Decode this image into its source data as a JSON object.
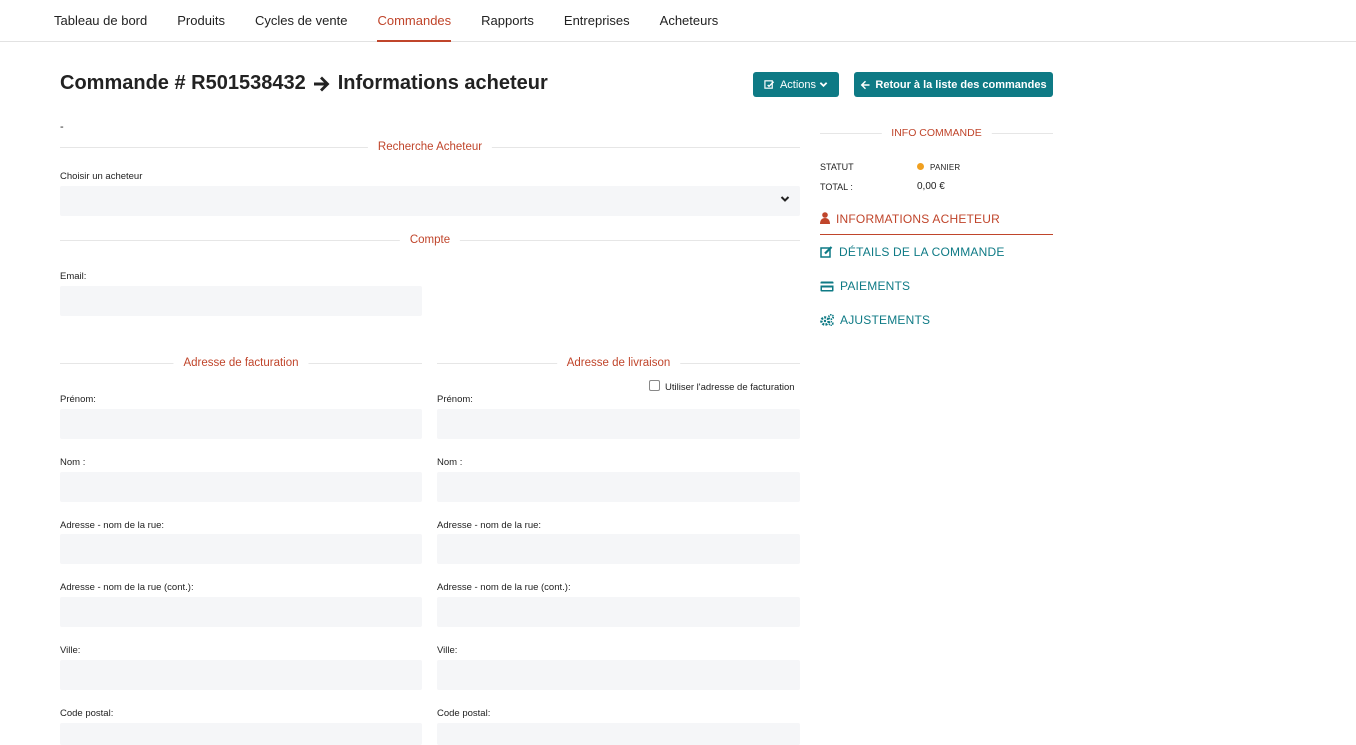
{
  "nav": {
    "items": [
      "Tableau de bord",
      "Produits",
      "Cycles de vente",
      "Commandes",
      "Rapports",
      "Entreprises",
      "Acheteurs"
    ],
    "active": "Commandes"
  },
  "header": {
    "title_prefix": "Commande # R501538432",
    "title_suffix": "Informations acheteur",
    "actions_label": "Actions",
    "back_label": "Retour à la liste des commandes"
  },
  "dash": "-",
  "buyer_search": {
    "section_title": "Recherche Acheteur",
    "label": "Choisir un acheteur",
    "value": ""
  },
  "account": {
    "section_title": "Compte",
    "email_label": "Email:",
    "email_value": ""
  },
  "billing": {
    "section_title": "Adresse de facturation",
    "fields": [
      {
        "label": "Prénom:",
        "value": ""
      },
      {
        "label": "Nom :",
        "value": ""
      },
      {
        "label": "Adresse - nom de la rue:",
        "value": ""
      },
      {
        "label": "Adresse - nom de la rue (cont.):",
        "value": ""
      },
      {
        "label": "Ville:",
        "value": ""
      },
      {
        "label": "Code postal:",
        "value": ""
      }
    ]
  },
  "shipping": {
    "section_title": "Adresse de livraison",
    "use_billing_label": "Utiliser l'adresse de facturation",
    "use_billing_checked": false,
    "fields": [
      {
        "label": "Prénom:",
        "value": ""
      },
      {
        "label": "Nom :",
        "value": ""
      },
      {
        "label": "Adresse - nom de la rue:",
        "value": ""
      },
      {
        "label": "Adresse - nom de la rue (cont.):",
        "value": ""
      },
      {
        "label": "Ville:",
        "value": ""
      },
      {
        "label": "Code postal:",
        "value": ""
      }
    ]
  },
  "order_info": {
    "title": "INFO COMMANDE",
    "status_label": "STATUT",
    "status_value": "PANIER",
    "status_color": "#f0a020",
    "total_label": "TOTAL :",
    "total_value": "0,00 €"
  },
  "side_menu": [
    {
      "label": "INFORMATIONS ACHETEUR",
      "icon": "user-icon",
      "active": true
    },
    {
      "label": "DÉTAILS DE LA COMMANDE",
      "icon": "edit-icon",
      "active": false
    },
    {
      "label": "PAIEMENTS",
      "icon": "credit-card-icon",
      "active": false
    },
    {
      "label": "AJUSTEMENTS",
      "icon": "cogs-icon",
      "active": false
    }
  ],
  "colors": {
    "accent": "#c0452b",
    "primary": "#0e7a85",
    "field_bg": "#f5f6f8"
  }
}
